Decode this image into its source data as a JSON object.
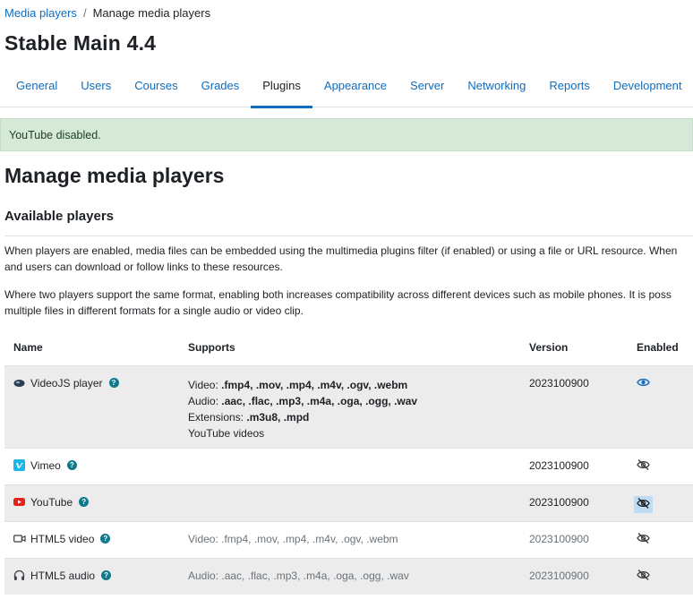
{
  "breadcrumb": {
    "parent": "Media players",
    "separator": "/",
    "current": "Manage media players"
  },
  "site_title": "Stable Main 4.4",
  "tabs": [
    {
      "label": "General"
    },
    {
      "label": "Users"
    },
    {
      "label": "Courses"
    },
    {
      "label": "Grades"
    },
    {
      "label": "Plugins",
      "active": true
    },
    {
      "label": "Appearance"
    },
    {
      "label": "Server"
    },
    {
      "label": "Networking"
    },
    {
      "label": "Reports"
    },
    {
      "label": "Development"
    }
  ],
  "alert": "YouTube disabled.",
  "page_heading": "Manage media players",
  "section_heading": "Available players",
  "para1": {
    "line1": "When players are enabled, media files can be embedded using the multimedia plugins filter (if enabled) or using a file or URL resource. When",
    "line2": "and users can download or follow links to these resources."
  },
  "para2": {
    "line1": "Where two players support the same format, enabling both increases compatibility across different devices such as mobile phones. It is poss",
    "line2": "multiple files in different formats for a single audio or video clip."
  },
  "table": {
    "headers": {
      "name": "Name",
      "supports": "Supports",
      "version": "Version",
      "enabled": "Enabled"
    },
    "rows": [
      {
        "name": "VideoJS player",
        "icon": "videojs-icon",
        "supports": {
          "video_prefix": "Video: ",
          "video": ".fmp4, .mov, .mp4, .m4v, .ogv, .webm",
          "audio_prefix": "Audio: ",
          "audio": ".aac, .flac, .mp3, .m4a, .oga, .ogg, .wav",
          "ext_prefix": "Extensions: ",
          "ext": ".m3u8, .mpd",
          "extra": "YouTube videos"
        },
        "version": "2023100900",
        "enabled": true
      },
      {
        "name": "Vimeo",
        "icon": "vimeo-icon",
        "version": "2023100900",
        "enabled": false
      },
      {
        "name": "YouTube",
        "icon": "youtube-icon",
        "version": "2023100900",
        "enabled": false
      },
      {
        "name": "HTML5 video",
        "icon": "video-camera-icon",
        "supports_text": "Video: .fmp4, .mov, .mp4, .m4v, .ogv, .webm",
        "version": "2023100900",
        "enabled": false
      },
      {
        "name": "HTML5 audio",
        "icon": "headphones-icon",
        "supports_text": "Audio: .aac, .flac, .mp3, .m4a, .oga, .ogg, .wav",
        "version": "2023100900",
        "enabled": false
      }
    ]
  },
  "help_glyph": "?",
  "colors": {
    "link": "#0f6cbf",
    "alert_bg": "#d6e9d8",
    "help": "#0f7a8c"
  }
}
